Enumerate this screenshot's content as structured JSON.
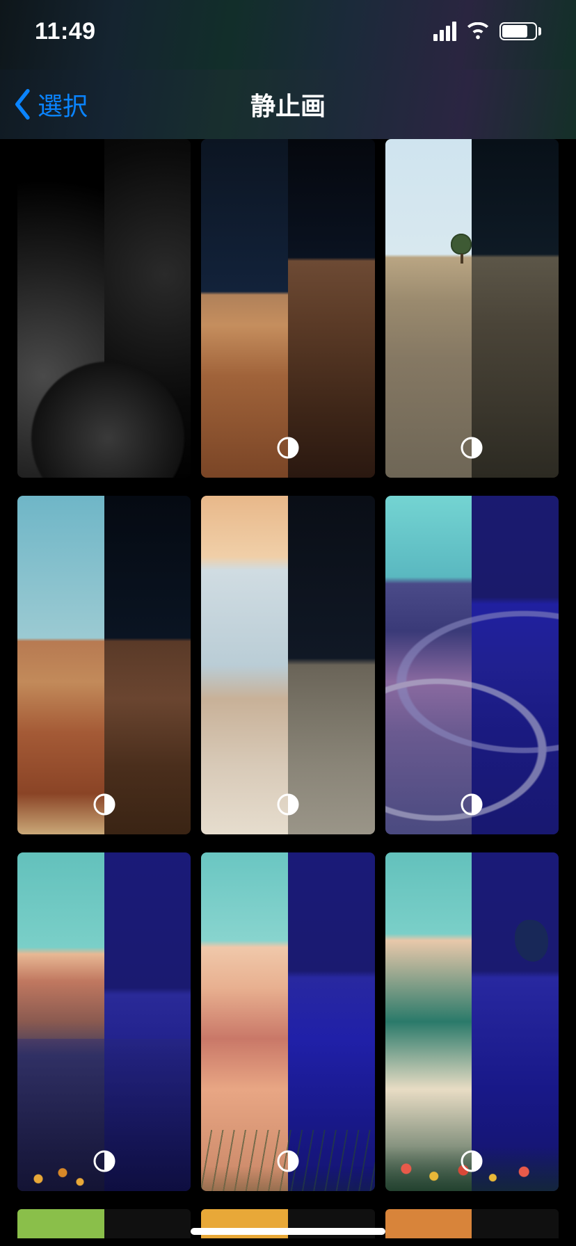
{
  "status": {
    "time": "11:49"
  },
  "nav": {
    "back_label": "選択",
    "title": "静止画"
  },
  "wallpapers": [
    {
      "name": "ios13-dark-gray",
      "has_dark_variant": true
    },
    {
      "name": "coyote-buttes",
      "has_dark_variant": true
    },
    {
      "name": "layered-rock-tree",
      "has_dark_variant": true
    },
    {
      "name": "vermilion-cliffs",
      "has_dark_variant": true
    },
    {
      "name": "white-pocket-rock",
      "has_dark_variant": true
    },
    {
      "name": "illustrated-cliff-road",
      "has_dark_variant": true
    },
    {
      "name": "illustrated-lake",
      "has_dark_variant": true
    },
    {
      "name": "illustrated-dunes",
      "has_dark_variant": true
    },
    {
      "name": "illustrated-beach",
      "has_dark_variant": true
    },
    {
      "name": "solid-green",
      "has_dark_variant": true
    },
    {
      "name": "solid-amber",
      "has_dark_variant": true
    },
    {
      "name": "solid-orange",
      "has_dark_variant": true
    }
  ]
}
